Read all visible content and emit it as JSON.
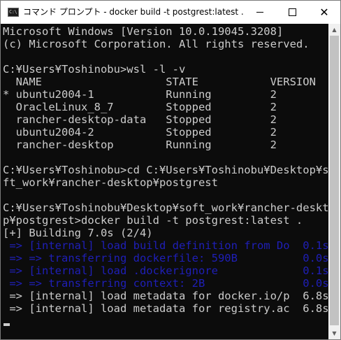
{
  "window": {
    "title": "コマンド プロンプト - docker  build -t postgrest:latest .",
    "icon_label": "C:\\",
    "controls": {
      "minimize_icon": "minimize-icon",
      "maximize_icon": "maximize-icon",
      "close_icon": "close-icon",
      "close_glyph": "✕"
    }
  },
  "console": {
    "lines": [
      "Microsoft Windows [Version 10.0.19045.3208]",
      "(c) Microsoft Corporation. All rights reserved.",
      "",
      "C:¥Users¥Toshinobu>wsl -l -v",
      "  NAME                   STATE           VERSION",
      "* ubuntu2004-1           Running         2",
      "  OracleLinux_8_7        Stopped         2",
      "  rancher-desktop-data   Stopped         2",
      "  ubuntu2004-2           Stopped         2",
      "  rancher-desktop        Running         2",
      "",
      "C:¥Users¥Toshinobu>cd C:¥Users¥Toshinobu¥Desktop¥so",
      "ft_work¥rancher-desktop¥postgrest",
      "",
      "C:¥Users¥Toshinobu¥Desktop¥soft_work¥rancher-deskto",
      "p¥postgrest>docker build -t postgrest:latest .",
      "[+] Building 7.0s (2/4)",
      " => [internal] load build definition from Do  0.1s",
      " => => transferring dockerfile: 590B          0.0s",
      " => [internal] load .dockerignore             0.1s",
      " => => transferring context: 2B               0.0s",
      " => [internal] load metadata for docker.io/p  6.8s",
      " => [internal] load metadata for registry.ac  6.8s"
    ],
    "colors": {
      "background": "#0c0c0c",
      "text": "#cccccc",
      "dim_blue": "#1f1fb8"
    }
  }
}
